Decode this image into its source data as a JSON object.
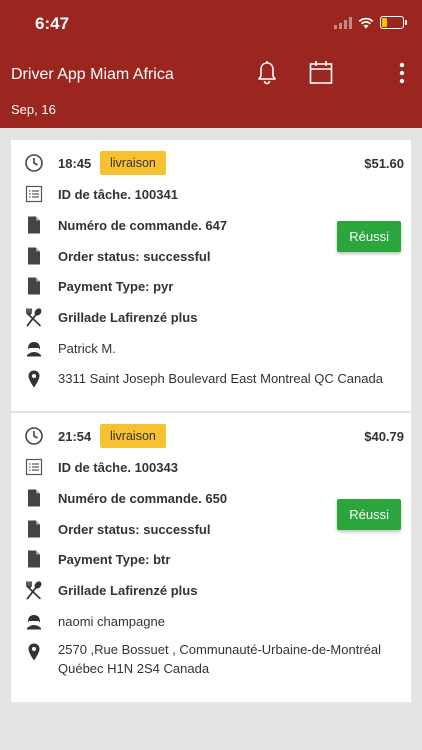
{
  "status_bar": {
    "time": "6:47"
  },
  "header": {
    "title": "Driver App Miam Africa",
    "date": "Sep, 16",
    "bell_icon": "bell-icon",
    "calendar_icon": "calendar-icon",
    "menu_icon": "more-vertical-icon"
  },
  "colors": {
    "header": "#9b2620",
    "badge": "#f7c12f",
    "success": "#2aa63d"
  },
  "orders": [
    {
      "time": "18:45",
      "type": "livraison",
      "price": "$51.60",
      "task_id": "ID de tâche. 100341",
      "order_number": "Numéro de commande. 647",
      "order_status": "Order status: successful",
      "payment_type": "Payment Type: pyr",
      "restaurant": "Grillade Lafirenzé plus",
      "customer": "Patrick M.",
      "address": "3311 Saint Joseph Boulevard East Montreal QC Canada",
      "status_button": "Réussi"
    },
    {
      "time": "21:54",
      "type": "livraison",
      "price": "$40.79",
      "task_id": "ID de tâche. 100343",
      "order_number": "Numéro de commande. 650",
      "order_status": "Order status: successful",
      "payment_type": "Payment Type: btr",
      "restaurant": "Grillade Lafirenzé plus",
      "customer": "naomi champagne",
      "address": "2570 ,Rue Bossuet , Communauté-Urbaine-de-Montréal Québec H1N 2S4 Canada",
      "status_button": "Réussi"
    }
  ]
}
